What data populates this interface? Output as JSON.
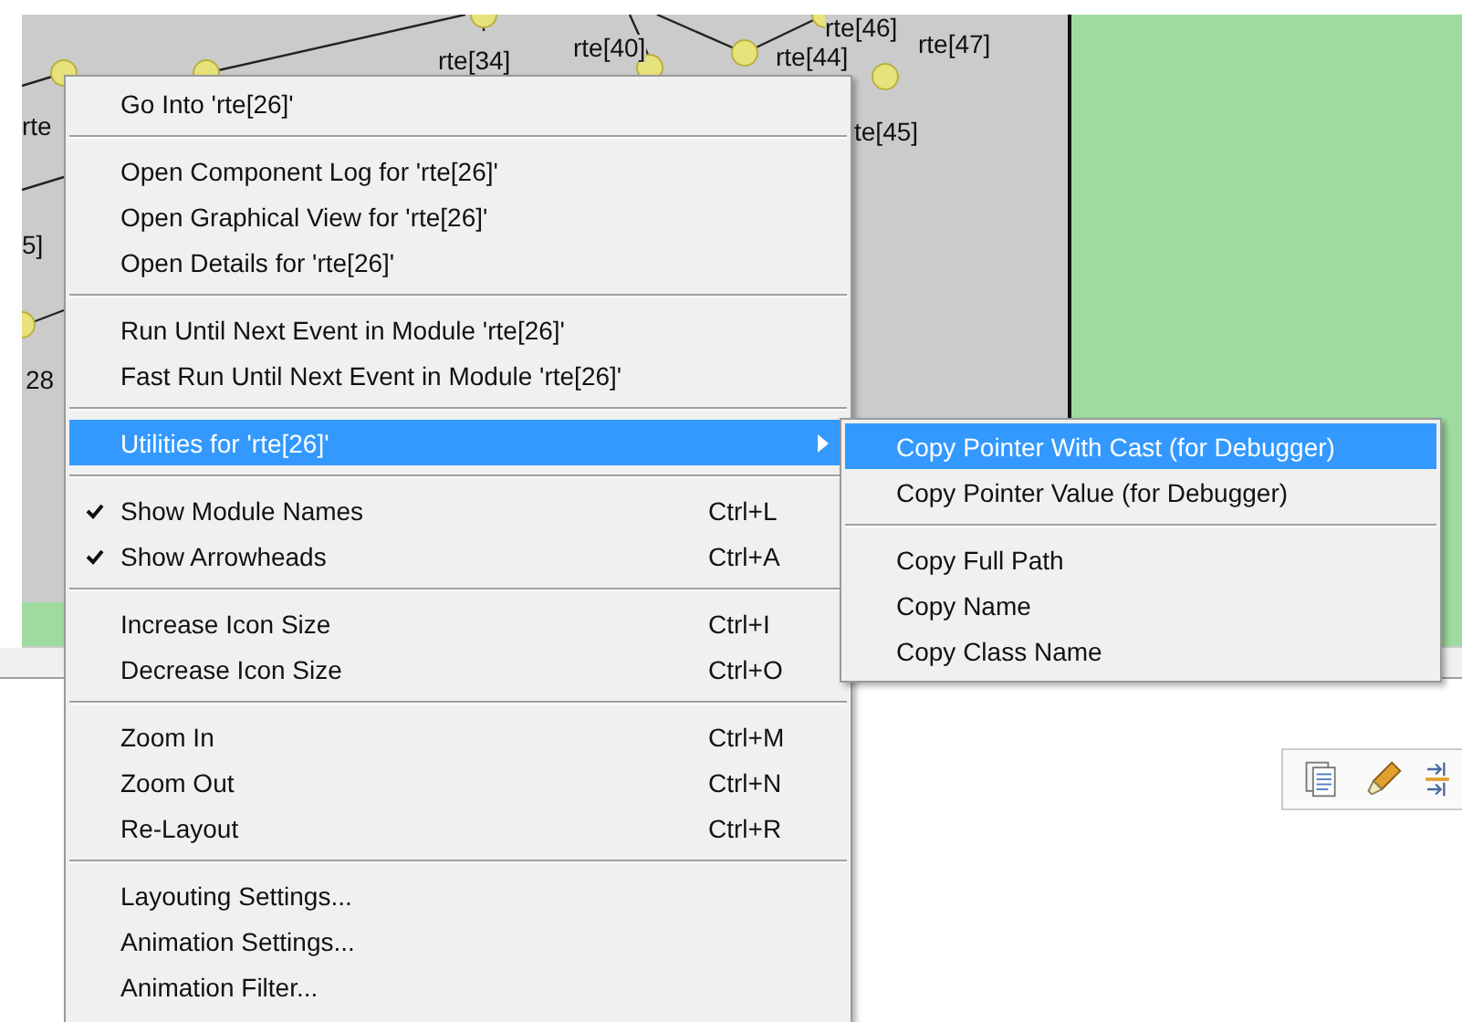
{
  "diagram": {
    "labels": [
      "rte[34]",
      "rte[40]",
      "rte[44]",
      "rte[46]",
      "rte[47]",
      "te[45]",
      "rte",
      "5]",
      "28"
    ]
  },
  "context_menu": {
    "items": [
      {
        "kind": "item",
        "label": "Go Into 'rte[26]'",
        "checked": false,
        "selected": false
      },
      {
        "kind": "separator"
      },
      {
        "kind": "item",
        "label": "Open Component Log for 'rte[26]'",
        "checked": false,
        "selected": false
      },
      {
        "kind": "item",
        "label": "Open Graphical View for 'rte[26]'",
        "checked": false,
        "selected": false
      },
      {
        "kind": "item",
        "label": "Open Details for 'rte[26]'",
        "checked": false,
        "selected": false
      },
      {
        "kind": "separator"
      },
      {
        "kind": "item",
        "label": "Run Until Next Event in Module 'rte[26]'",
        "checked": false,
        "selected": false
      },
      {
        "kind": "item",
        "label": "Fast Run Until Next Event in Module 'rte[26]'",
        "checked": false,
        "selected": false
      },
      {
        "kind": "separator"
      },
      {
        "kind": "submenu",
        "label": "Utilities for 'rte[26]'",
        "checked": false,
        "selected": true
      },
      {
        "kind": "separator"
      },
      {
        "kind": "item",
        "label": "Show Module Names",
        "shortcut": "Ctrl+L",
        "checked": true,
        "selected": false
      },
      {
        "kind": "item",
        "label": "Show Arrowheads",
        "shortcut": "Ctrl+A",
        "checked": true,
        "selected": false
      },
      {
        "kind": "separator"
      },
      {
        "kind": "item",
        "label": "Increase Icon Size",
        "shortcut": "Ctrl+I",
        "checked": false,
        "selected": false
      },
      {
        "kind": "item",
        "label": "Decrease Icon Size",
        "shortcut": "Ctrl+O",
        "checked": false,
        "selected": false
      },
      {
        "kind": "separator"
      },
      {
        "kind": "item",
        "label": "Zoom In",
        "shortcut": "Ctrl+M",
        "checked": false,
        "selected": false
      },
      {
        "kind": "item",
        "label": "Zoom Out",
        "shortcut": "Ctrl+N",
        "checked": false,
        "selected": false
      },
      {
        "kind": "item",
        "label": "Re-Layout",
        "shortcut": "Ctrl+R",
        "checked": false,
        "selected": false
      },
      {
        "kind": "separator"
      },
      {
        "kind": "item",
        "label": "Layouting Settings...",
        "checked": false,
        "selected": false
      },
      {
        "kind": "item",
        "label": "Animation Settings...",
        "checked": false,
        "selected": false
      },
      {
        "kind": "item",
        "label": "Animation Filter...",
        "checked": false,
        "selected": false
      }
    ]
  },
  "submenu": {
    "items": [
      {
        "kind": "item",
        "label": "Copy Pointer With Cast (for Debugger)",
        "selected": true
      },
      {
        "kind": "item",
        "label": "Copy Pointer Value (for Debugger)",
        "selected": false
      },
      {
        "kind": "separator"
      },
      {
        "kind": "item",
        "label": "Copy Full Path",
        "selected": false
      },
      {
        "kind": "item",
        "label": "Copy Name",
        "selected": false
      },
      {
        "kind": "item",
        "label": "Copy Class Name",
        "selected": false
      }
    ]
  }
}
